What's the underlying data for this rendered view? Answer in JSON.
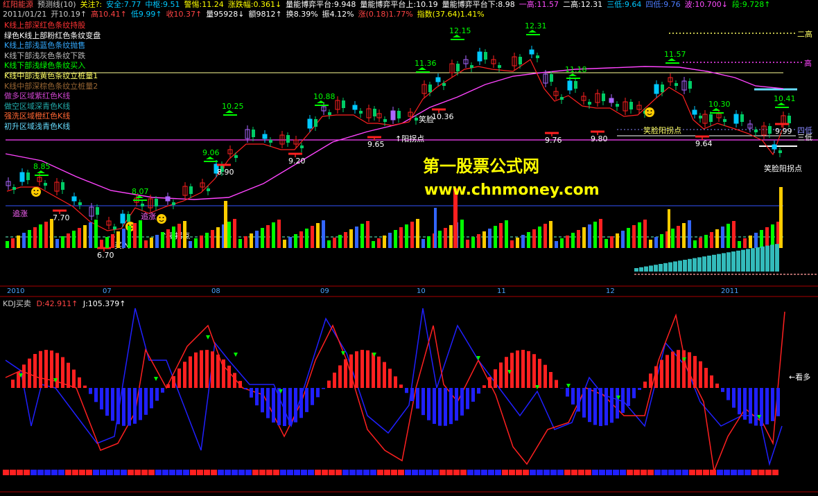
{
  "header": {
    "row1": [
      {
        "text": "红阳能源",
        "color": "#ff4444"
      },
      {
        "text": "预测线(10)",
        "color": "#cccccc"
      },
      {
        "text": "关注?:",
        "color": "#ffff00"
      },
      {
        "text": "安全:7.77",
        "color": "#00c8ff"
      },
      {
        "text": "中枢:9.51",
        "color": "#00c8ff"
      },
      {
        "text": "警惕:11.24",
        "color": "#ffff00"
      },
      {
        "text": "涨跌幅:0.361↓",
        "color": "#ffff00"
      },
      {
        "text": "量能博弈平台:9.948",
        "color": "#ffffff"
      },
      {
        "text": "量能博弈平台上:10.19",
        "color": "#ffffff"
      },
      {
        "text": "量能博弈平台下:8.98",
        "color": "#ffffff"
      },
      {
        "text": "一高:11.57",
        "color": "#ff4dff"
      },
      {
        "text": "二高:12.31",
        "color": "#ffffff"
      },
      {
        "text": "三低:9.64",
        "color": "#00c8ff"
      },
      {
        "text": "四低:9.76",
        "color": "#4d7dff"
      },
      {
        "text": "波:10.700↓",
        "color": "#ff4dff"
      },
      {
        "text": "段:9.728↑",
        "color": "#00ff00"
      }
    ],
    "row2": [
      {
        "text": "2011/01/21",
        "color": "#cccccc"
      },
      {
        "text": "开10.19↑",
        "color": "#cccccc"
      },
      {
        "text": "高10.41↑",
        "color": "#ff4444"
      },
      {
        "text": "低9.99↑",
        "color": "#00c8ff"
      },
      {
        "text": "收10.37↑",
        "color": "#ff4444"
      },
      {
        "text": "量95928↓",
        "color": "#ffffff"
      },
      {
        "text": "额9812↑",
        "color": "#ffffff"
      },
      {
        "text": "换8.39%",
        "color": "#ffffff"
      },
      {
        "text": "振4.12%",
        "color": "#ffffff"
      },
      {
        "text": "涨(0.18)1.77%",
        "color": "#ff4444"
      },
      {
        "text": "指数(37.64)1.41%",
        "color": "#ffff00"
      }
    ]
  },
  "legend": [
    {
      "text": "K线上部深红色条纹持股",
      "color": "#ff3333"
    },
    {
      "text": "绿色K线上部粉红色条纹变盘",
      "color": "#ffffff"
    },
    {
      "text": "K线上部浅蓝色条纹抛售",
      "color": "#33aaff"
    },
    {
      "text": "K线下部浅灰色条纹下跌",
      "color": "#bbbbbb"
    },
    {
      "text": "K线下部浅绿色条纹买入",
      "color": "#00ff00"
    },
    {
      "text": "K线中部浅黄色条纹立桩量1",
      "color": "#ffff66"
    },
    {
      "text": "K线中部深棕色条纹立桩量2",
      "color": "#996633"
    },
    {
      "text": "做多区域紫红色K线",
      "color": "#cc44cc"
    },
    {
      "text": "做空区域深青色K线",
      "color": "#22aaaa"
    },
    {
      "text": "强洗区域橙红色K线",
      "color": "#ff6633"
    },
    {
      "text": "初升区域浅青色K线",
      "color": "#66ddff"
    }
  ],
  "watermark": {
    "line1": "第一股票公式网",
    "line2": "www.chnmoney.com"
  },
  "right_labels": {
    "er_gao": "二高",
    "yi_gao": "高",
    "si_di": "四低",
    "san_di": "三低"
  },
  "price_labels": [
    {
      "text": "8.85",
      "color": "#00ff00"
    },
    {
      "text": "7.70",
      "color": "#ffffff"
    },
    {
      "text": "6.70",
      "color": "#ffffff"
    },
    {
      "text": "8.07",
      "color": "#00ff00"
    },
    {
      "text": "9.06",
      "color": "#00ff00"
    },
    {
      "text": "8.90",
      "color": "#ffffff"
    },
    {
      "text": "10.25",
      "color": "#00ff00"
    },
    {
      "text": "9.20",
      "color": "#ffffff"
    },
    {
      "text": "10.88",
      "color": "#00ff00"
    },
    {
      "text": "9.65",
      "color": "#ffffff"
    },
    {
      "text": "11.36",
      "color": "#00ff00"
    },
    {
      "text": "10.36",
      "color": "#ffffff"
    },
    {
      "text": "12.15",
      "color": "#00ff00"
    },
    {
      "text": "12.31",
      "color": "#00ff00"
    },
    {
      "text": "11.18",
      "color": "#00ff00"
    },
    {
      "text": "9.76",
      "color": "#ffffff"
    },
    {
      "text": "9.80",
      "color": "#ffffff"
    },
    {
      "text": "11.57",
      "color": "#00ff00"
    },
    {
      "text": "10.30",
      "color": "#00ff00"
    },
    {
      "text": "9.64",
      "color": "#ffffff"
    },
    {
      "text": "10.41",
      "color": "#00ff00"
    },
    {
      "text": "9.99",
      "color": "#ffffff"
    }
  ],
  "annotations": {
    "zhuizhang": "追涨",
    "mairu": "买入",
    "yangguai": "↑阳拐点",
    "xiaolian": "笑脸",
    "xiaolian_yangguai": "笑脸阳拐点"
  },
  "timeline": [
    "2010",
    "07",
    "08",
    "09",
    "10",
    "11",
    "12",
    "2011"
  ],
  "kdj": {
    "name": "KDJ买卖",
    "d_label": "D:42.911↑",
    "j_label": "J:105.379↑",
    "signal": "←看多"
  },
  "colors": {
    "up": "#ff2020",
    "down": "#00c8ff",
    "green": "#00ff00",
    "ma_pink": "#ff44ff",
    "kdj_red": "#ff2020",
    "kdj_blue": "#2020ff"
  }
}
